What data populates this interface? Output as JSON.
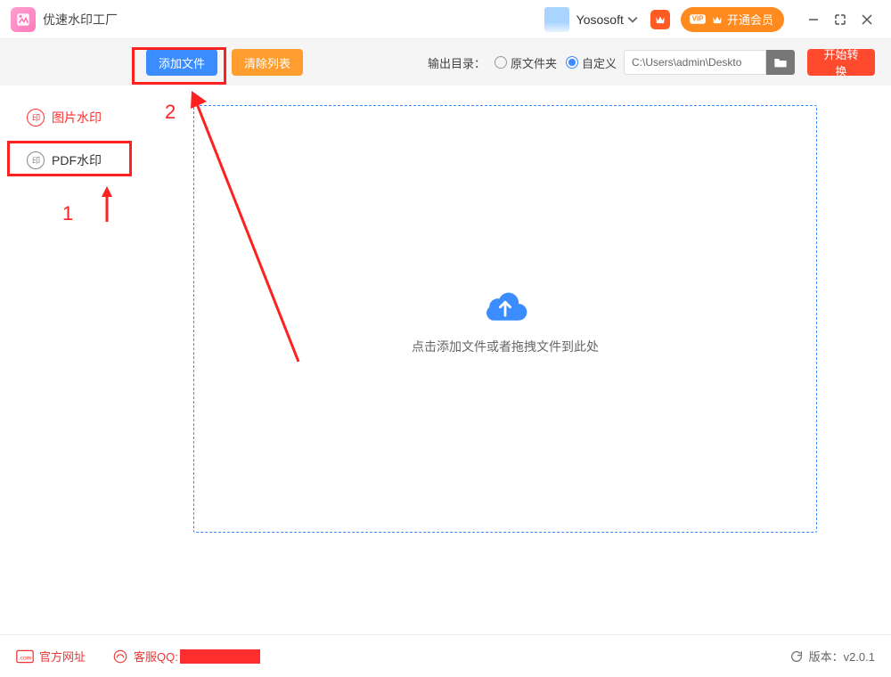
{
  "titlebar": {
    "app_title": "优速水印工厂",
    "user_name": "Yososoft",
    "vip_button": "开通会员"
  },
  "toolbar": {
    "add_label": "添加文件",
    "clear_label": "清除列表",
    "output_label": "输出目录：",
    "radio_original": "原文件夹",
    "radio_custom": "自定义",
    "path_value": "C:\\Users\\admin\\Deskto",
    "start_label": "开始转换"
  },
  "sidebar": {
    "items": [
      {
        "label": "图片水印",
        "active": true
      },
      {
        "label": "PDF水印",
        "active": false
      }
    ]
  },
  "dropzone": {
    "text": "点击添加文件或者拖拽文件到此处"
  },
  "footer": {
    "site_label": "官方网址",
    "qq_label": "客服QQ:",
    "version_label": "版本：v2.0.1"
  },
  "annotations": {
    "label1": "1",
    "label2": "2"
  }
}
